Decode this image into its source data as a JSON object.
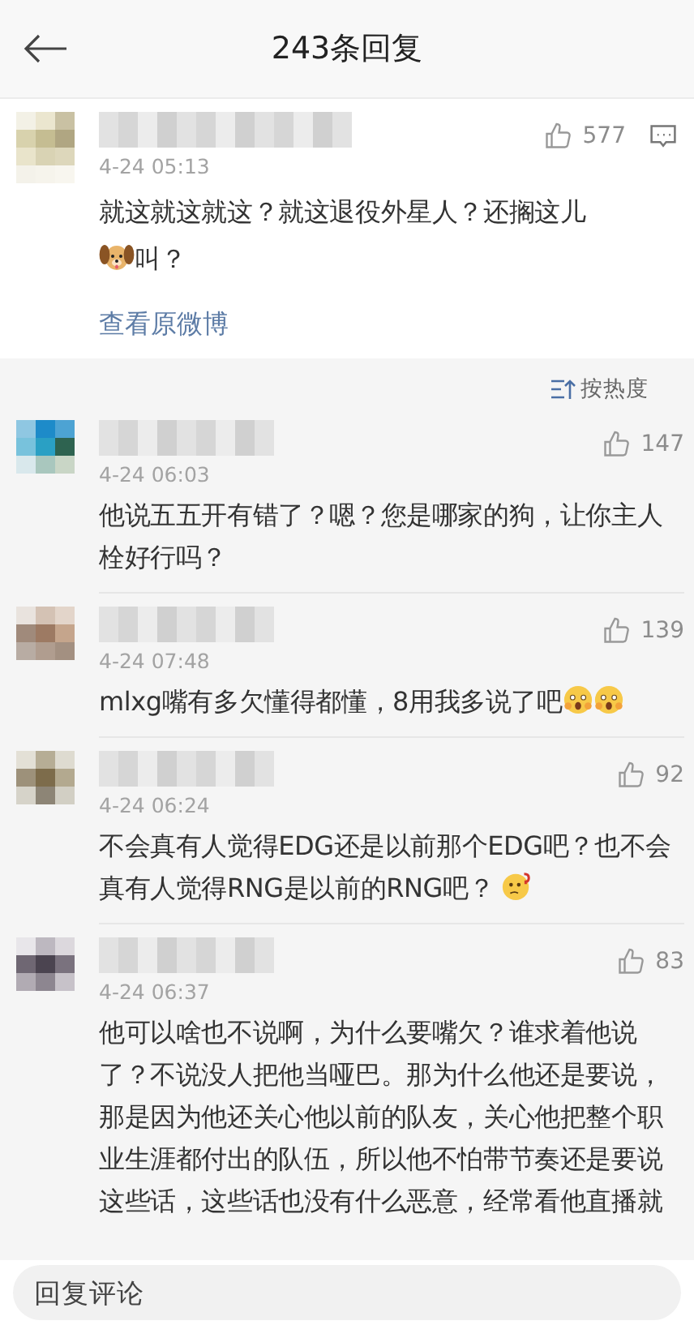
{
  "header": {
    "title": "243条回复"
  },
  "main_comment": {
    "like_count": "577",
    "time": "4-24 05:13",
    "content": [
      {
        "kind": "text",
        "text": "就这就这就这？就这退役外星人？还搁这儿"
      },
      {
        "kind": "dog-emoji"
      },
      {
        "kind": "text",
        "text": "叫？"
      }
    ],
    "link": "查看原微博"
  },
  "sort": {
    "label": "按热度"
  },
  "replies": [
    {
      "time": "4-24 06:03",
      "like_count": "147",
      "content": [
        {
          "kind": "text",
          "text": "他说五五开有错了？嗯？您是哪家的狗，让你主人栓好行吗？"
        }
      ]
    },
    {
      "time": "4-24 07:48",
      "like_count": "139",
      "content": [
        {
          "kind": "text",
          "text": "mlxg嘴有多欠懂得都懂，8用我多说了吧"
        },
        {
          "kind": "fear-emoji"
        },
        {
          "kind": "fear-emoji"
        }
      ]
    },
    {
      "time": "4-24 06:24",
      "like_count": "92",
      "content": [
        {
          "kind": "text",
          "text": "不会真有人觉得EDG还是以前那个EDG吧？也不会真有人觉得RNG是以前的RNG吧？ "
        },
        {
          "kind": "thinking-emoji"
        }
      ]
    },
    {
      "time": "4-24 06:37",
      "like_count": "83",
      "content": [
        {
          "kind": "text",
          "text": "他可以啥也不说啊，为什么要嘴欠？谁求着他说了？不说没人把他当哑巴。那为什么他还是要说，那是因为他还关心他以前的队友，关心他把整个职业生涯都付出的队伍，所以他不怕带节奏还是要说这些话，这些话也没有什么恶意，经常看他直播就"
        }
      ]
    }
  ],
  "reply_bar": {
    "placeholder": "回复评论"
  }
}
